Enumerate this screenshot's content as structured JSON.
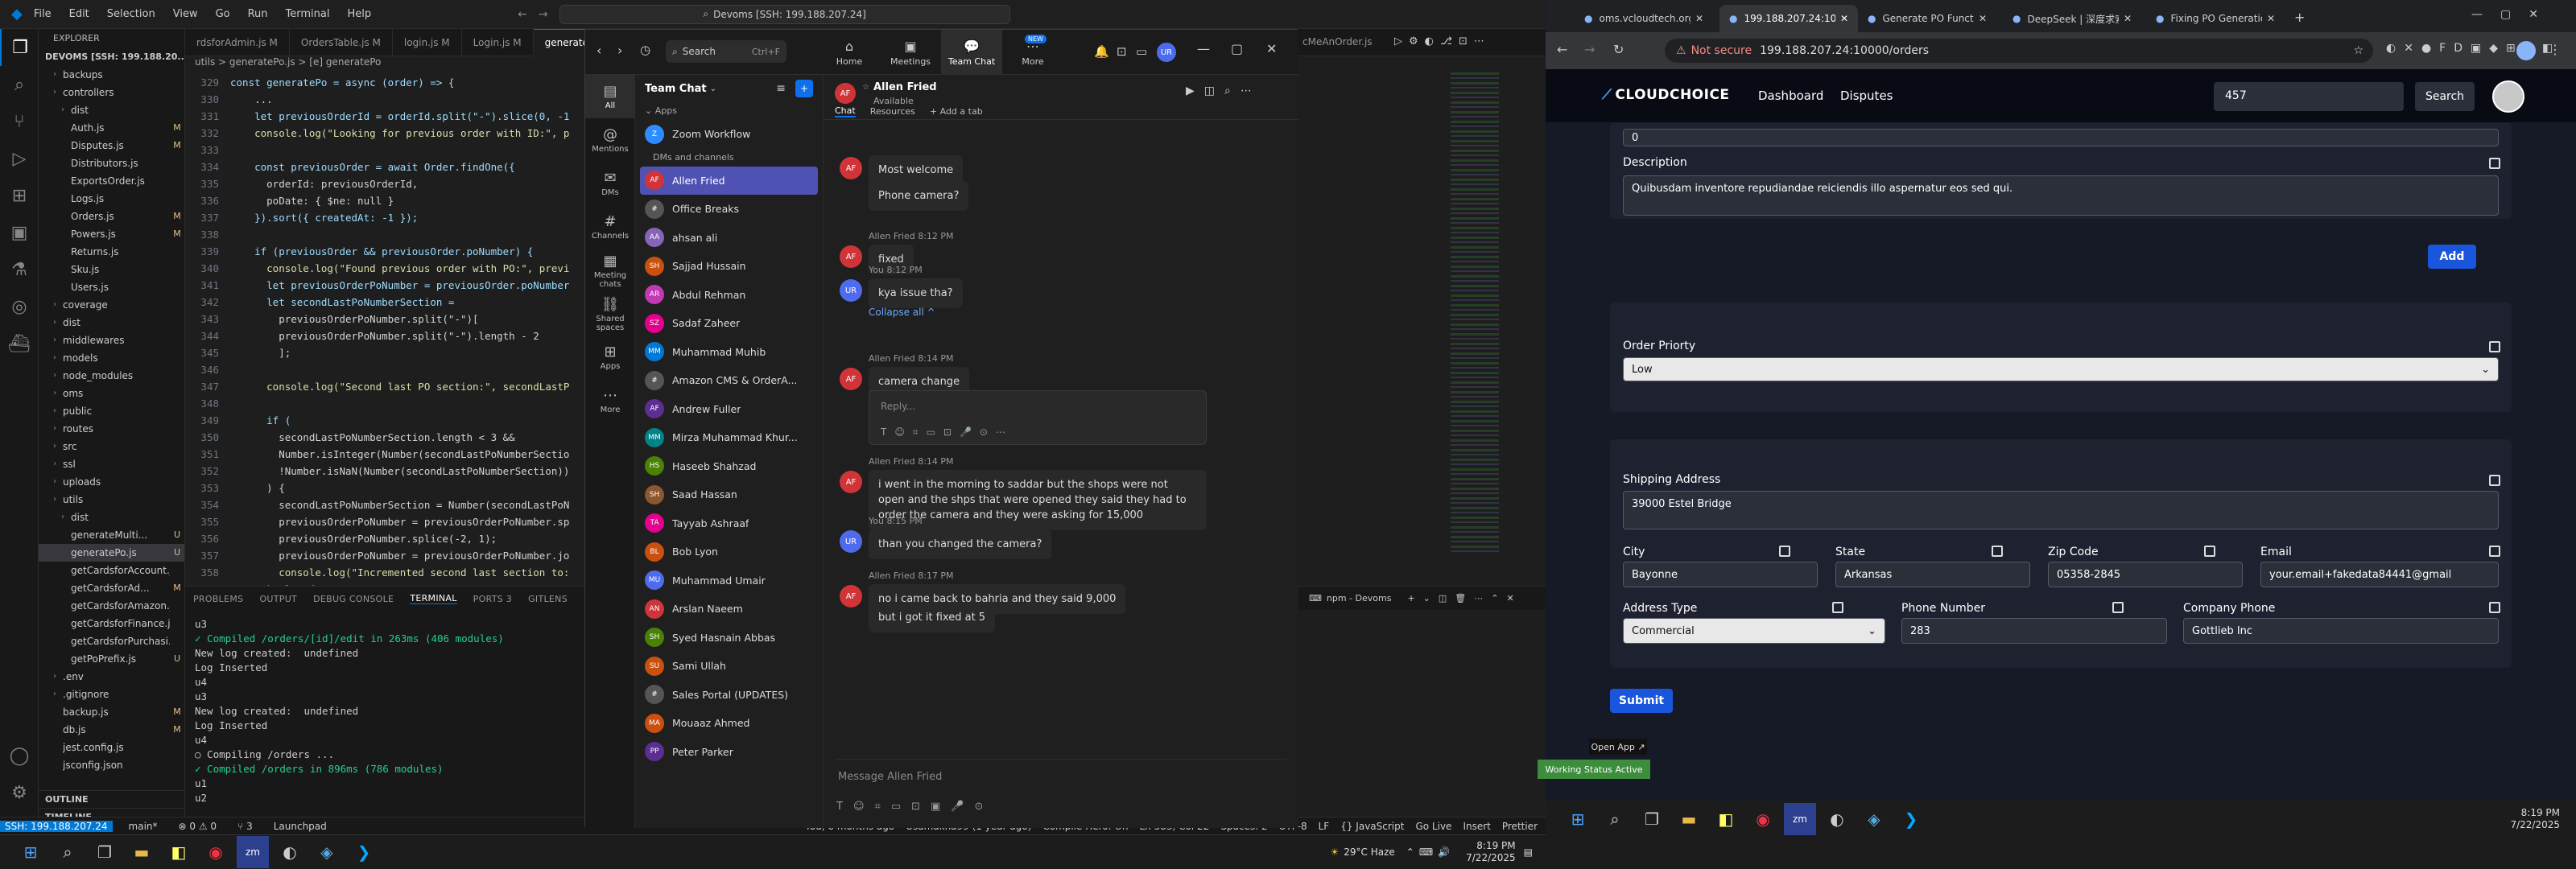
{
  "vscode": {
    "menu": [
      "File",
      "Edit",
      "Selection",
      "View",
      "Go",
      "Run",
      "Terminal",
      "Help"
    ],
    "search": "Devoms [SSH: 199.188.207.24]",
    "explorer_label": "EXPLORER",
    "root": "DEVOMS [SSH: 199.188.20...",
    "files": [
      {
        "name": "backups",
        "depth": 1,
        "status": ""
      },
      {
        "name": "controllers",
        "depth": 1,
        "status": ""
      },
      {
        "name": "dist",
        "depth": 2,
        "status": ""
      },
      {
        "name": "Auth.js",
        "depth": 2,
        "status": "M"
      },
      {
        "name": "Disputes.js",
        "depth": 2,
        "status": "M"
      },
      {
        "name": "Distributors.js",
        "depth": 2,
        "status": ""
      },
      {
        "name": "ExportsOrder.js",
        "depth": 2,
        "status": ""
      },
      {
        "name": "Logs.js",
        "depth": 2,
        "status": ""
      },
      {
        "name": "Orders.js",
        "depth": 2,
        "status": "M"
      },
      {
        "name": "Powers.js",
        "depth": 2,
        "status": "M"
      },
      {
        "name": "Returns.js",
        "depth": 2,
        "status": ""
      },
      {
        "name": "Sku.js",
        "depth": 2,
        "status": ""
      },
      {
        "name": "Users.js",
        "depth": 2,
        "status": ""
      },
      {
        "name": "coverage",
        "depth": 1,
        "status": ""
      },
      {
        "name": "dist",
        "depth": 1,
        "status": ""
      },
      {
        "name": "middlewares",
        "depth": 1,
        "status": ""
      },
      {
        "name": "models",
        "depth": 1,
        "status": ""
      },
      {
        "name": "node_modules",
        "depth": 1,
        "status": ""
      },
      {
        "name": "oms",
        "depth": 1,
        "status": ""
      },
      {
        "name": "public",
        "depth": 1,
        "status": ""
      },
      {
        "name": "routes",
        "depth": 1,
        "status": ""
      },
      {
        "name": "src",
        "depth": 1,
        "status": ""
      },
      {
        "name": "ssl",
        "depth": 1,
        "status": ""
      },
      {
        "name": "uploads",
        "depth": 1,
        "status": ""
      },
      {
        "name": "utils",
        "depth": 1,
        "status": ""
      },
      {
        "name": "dist",
        "depth": 2,
        "status": ""
      },
      {
        "name": "generateMulti...",
        "depth": 2,
        "status": "U"
      },
      {
        "name": "generatePo.js",
        "depth": 2,
        "status": "U"
      },
      {
        "name": "getCardsforAccount.js",
        "depth": 2,
        "status": ""
      },
      {
        "name": "getCardsforAd...",
        "depth": 2,
        "status": "M"
      },
      {
        "name": "getCardsforAmazon.js",
        "depth": 2,
        "status": ""
      },
      {
        "name": "getCardsforFinance.js",
        "depth": 2,
        "status": ""
      },
      {
        "name": "getCardsforPurchasi...",
        "depth": 2,
        "status": ""
      },
      {
        "name": "getPoPrefix.js",
        "depth": 2,
        "status": "U"
      },
      {
        "name": ".env",
        "depth": 1,
        "status": ""
      },
      {
        "name": ".gitignore",
        "depth": 1,
        "status": ""
      },
      {
        "name": "backup.js",
        "depth": 1,
        "status": "M"
      },
      {
        "name": "db.js",
        "depth": 1,
        "status": "M"
      },
      {
        "name": "jest.config.js",
        "depth": 1,
        "status": ""
      },
      {
        "name": "jsconfig.json",
        "depth": 1,
        "status": ""
      }
    ],
    "outline": "OUTLINE",
    "timeline": "TIMELINE",
    "tabs": [
      {
        "label": "rdsforAdmin.js M"
      },
      {
        "label": "OrdersTable.js M"
      },
      {
        "label": "login.js M"
      },
      {
        "label": "Login.js M"
      },
      {
        "label": "generatePo.js U"
      },
      {
        "label": "cMeAnOrder.js"
      }
    ],
    "breadcrumb": "utils  >  generatePo.js  >  [e] generatePo",
    "code": [
      {
        "n": "329",
        "t": "const generatePo = async (order) => {"
      },
      {
        "n": "330",
        "t": "    ..."
      },
      {
        "n": "331",
        "t": "    let previousOrderId = orderId.split(\"-\").slice(0, -1"
      },
      {
        "n": "332",
        "t": "    console.log(\"Looking for previous order with ID:\", p"
      },
      {
        "n": "333",
        "t": ""
      },
      {
        "n": "334",
        "t": "    const previousOrder = await Order.findOne({"
      },
      {
        "n": "335",
        "t": "      orderId: previousOrderId,"
      },
      {
        "n": "336",
        "t": "      poDate: { $ne: null }"
      },
      {
        "n": "337",
        "t": "    }).sort({ createdAt: -1 });"
      },
      {
        "n": "338",
        "t": ""
      },
      {
        "n": "339",
        "t": "    if (previousOrder && previousOrder.poNumber) {"
      },
      {
        "n": "340",
        "t": "      console.log(\"Found previous order with PO:\", previ"
      },
      {
        "n": "341",
        "t": "      let previousOrderPoNumber = previousOrder.poNumber"
      },
      {
        "n": "342",
        "t": "      let secondLastPoNumberSection ="
      },
      {
        "n": "343",
        "t": "        previousOrderPoNumber.split(\"-\")["
      },
      {
        "n": "344",
        "t": "        previousOrderPoNumber.split(\"-\").length - 2"
      },
      {
        "n": "345",
        "t": "        ];"
      },
      {
        "n": "346",
        "t": ""
      },
      {
        "n": "347",
        "t": "      console.log(\"Second last PO section:\", secondLastP"
      },
      {
        "n": "348",
        "t": ""
      },
      {
        "n": "349",
        "t": "      if ("
      },
      {
        "n": "350",
        "t": "        secondLastPoNumberSection.length < 3 &&"
      },
      {
        "n": "351",
        "t": "        Number.isInteger(Number(secondLastPoNumberSectio"
      },
      {
        "n": "352",
        "t": "        !Number.isNaN(Number(secondLastPoNumberSection))"
      },
      {
        "n": "353",
        "t": "      ) {"
      },
      {
        "n": "354",
        "t": "        secondLastPoNumberSection = Number(secondLastPoN"
      },
      {
        "n": "355",
        "t": "        previousOrderPoNumber = previousOrderPoNumber.sp"
      },
      {
        "n": "356",
        "t": "        previousOrderPoNumber.splice(-2, 1);"
      },
      {
        "n": "357",
        "t": "        previousOrderPoNumber = previousOrderPoNumber.jo"
      },
      {
        "n": "358",
        "t": "        console.log(\"Incremented second last section to:"
      },
      {
        "n": "359",
        "t": "      } else {"
      },
      {
        "n": "360",
        "t": "        secondLastPoNumberSection = 1;"
      },
      {
        "n": "361",
        "t": "        console.log(\"Setting second last section to defa"
      }
    ],
    "panel_tabs": [
      "PROBLEMS",
      "OUTPUT",
      "DEBUG CONSOLE",
      "TERMINAL",
      "PORTS 3",
      "GITLENS"
    ],
    "terminal_label": "npm - Devoms",
    "terminal": [
      "u3",
      "✓ Compiled /orders/[id]/edit in 263ms (406 modules)",
      "New log created:  undefined",
      "Log Inserted",
      "u4",
      "u3",
      "New log created:  undefined",
      "Log Inserted",
      "u4",
      "○ Compiling /orders ...",
      "✓ Compiled /orders in 896ms (786 modules)",
      "u1",
      "u2"
    ],
    "status_left": [
      "SSH: 199.188.207.24",
      "main*",
      "⊗ 0 ⚠ 0",
      "⑂ 3",
      "Launchpad"
    ],
    "status_right": [
      "You, 6 months ago",
      "Usamakha99 (1 year ago)",
      "Compile Hero: On",
      "Ln 383, Col 22",
      "Spaces: 2",
      "UTF-8",
      "LF",
      "{} JavaScript",
      "Go Live",
      "Insert",
      "Prettier"
    ]
  },
  "taskbar_left": {
    "weather": "29°C  Haze",
    "time": "8:19 PM",
    "date": "7/22/2025"
  },
  "teams": {
    "search": "Search",
    "shortcut": "Ctrl+F",
    "top_nav": [
      "Home",
      "Meetings",
      "Team Chat",
      "More"
    ],
    "new_badge": "NEW",
    "user_initials": "UR",
    "rail": [
      "All",
      "Mentions",
      "DMs",
      "Channels",
      "Meeting chats",
      "Shared spaces",
      "Apps",
      "More"
    ],
    "list_title": "Team Chat",
    "apps_header": "Apps",
    "dms_header": "DMs and channels",
    "contacts": [
      {
        "name": "Zoom Workflow",
        "initials": "Z",
        "color": "#2d8cff"
      },
      {
        "name": "Allen Fried",
        "initials": "AF",
        "color": "#d13438",
        "selected": true
      },
      {
        "name": "Office Breaks",
        "initials": "#",
        "color": "#555"
      },
      {
        "name": "ahsan ali",
        "initials": "AA",
        "color": "#8764b8"
      },
      {
        "name": "Sajjad Hussain",
        "initials": "SH",
        "color": "#ca5010"
      },
      {
        "name": "Abdul Rehman",
        "initials": "AR",
        "color": "#c239b3"
      },
      {
        "name": "Sadaf Zaheer",
        "initials": "SZ",
        "color": "#e3008c"
      },
      {
        "name": "Muhammad Muhib",
        "initials": "MM",
        "color": "#0078d4"
      },
      {
        "name": "Amazon CMS & OrderA...",
        "initials": "#",
        "color": "#555"
      },
      {
        "name": "Andrew Fuller",
        "initials": "AF",
        "color": "#5c2e91"
      },
      {
        "name": "Mirza Muhammad Khur...",
        "initials": "MM",
        "color": "#038387"
      },
      {
        "name": "Haseeb Shahzad",
        "initials": "HS",
        "color": "#498205"
      },
      {
        "name": "Saad Hassan",
        "initials": "SH",
        "color": "#8e562e"
      },
      {
        "name": "Tayyab Ashraaf",
        "initials": "TA",
        "color": "#e3008c"
      },
      {
        "name": "Bob Lyon",
        "initials": "BL",
        "color": "#ca5010"
      },
      {
        "name": "Muhammad Umair",
        "initials": "MU",
        "color": "#4f6bed"
      },
      {
        "name": "Arslan Naeem",
        "initials": "AN",
        "color": "#d13438"
      },
      {
        "name": "Syed Hasnain Abbas",
        "initials": "SH",
        "color": "#498205"
      },
      {
        "name": "Sami Ullah",
        "initials": "SU",
        "color": "#ca5010"
      },
      {
        "name": "Sales Portal (UPDATES)",
        "initials": "#",
        "color": "#555"
      },
      {
        "name": "Mouaaz Ahmed",
        "initials": "MA",
        "color": "#ca5010"
      },
      {
        "name": "Peter Parker",
        "initials": "PP",
        "color": "#5c2e91"
      }
    ],
    "chat": {
      "name": "Allen Fried",
      "status": "Available",
      "tabs": [
        "Chat",
        "Resources",
        "+ Add a tab"
      ],
      "messages": [
        {
          "who": "AF",
          "text": "Most welcome",
          "meta": ""
        },
        {
          "who": "AF",
          "text": "Phone camera?",
          "meta": ""
        },
        {
          "who": "AF",
          "text": "fixed",
          "meta": "Allen Fried 8:12 PM"
        },
        {
          "who": "UR",
          "text": "kya issue tha?",
          "meta": "You 8:12 PM"
        },
        {
          "who": "AF",
          "text": "camera change",
          "meta": "Allen Fried 8:14 PM"
        },
        {
          "who": "AF",
          "text": "i went in the morning to saddar but the shops were not open and the shps that were opened they said they had to order the camera and they were asking for 15,000",
          "meta": "Allen Fried 8:14 PM"
        },
        {
          "who": "UR",
          "text": "than you changed the camera?",
          "meta": "You 8:15 PM"
        },
        {
          "who": "AF",
          "text": "no i came back to bahria and they said 9,000",
          "meta": "Allen Fried 8:17 PM"
        },
        {
          "who": "AF",
          "text": "but i got it fixed at 5",
          "meta": ""
        }
      ],
      "collapse": "Collapse all ^",
      "reply_placeholder": "Reply...",
      "compose_placeholder": "Message Allen Fried"
    }
  },
  "chrome": {
    "tabs": [
      "oms.vcloudtech.org/das",
      "199.188.207.24:10000/o",
      "Generate PO Function R",
      "DeepSeek | 深度求索",
      "Fixing PO Generation w"
    ],
    "not_secure": "Not secure",
    "url": "199.188.207.24:10000/orders"
  },
  "app": {
    "logo": "CLOUDCHOICE",
    "nav": [
      "Dashboard",
      "Disputes"
    ],
    "search_value": "457",
    "search_btn": "Search",
    "top_value": "0",
    "description_label": "Description",
    "description_value": "Quibusdam inventore repudiandae reiciendis illo aspernatur eos sed qui.",
    "add_btn": "Add",
    "priority_label": "Order Priorty",
    "priority_value": "Low",
    "shipping_label": "Shipping Address",
    "shipping_value": "39000 Estel Bridge",
    "city_label": "City",
    "city_value": "Bayonne",
    "state_label": "State",
    "state_value": "Arkansas",
    "zip_label": "Zip Code",
    "zip_value": "05358-2845",
    "email_label": "Email",
    "email_value": "your.email+fakedata84441@gmail",
    "address_type_label": "Address Type",
    "address_type_value": "Commercial",
    "phone_label": "Phone Number",
    "phone_value": "283",
    "company_phone_label": "Company Phone",
    "company_phone_value": "Gottlieb Inc",
    "submit_btn": "Submit",
    "open_app": "Open App ↗",
    "working_status": "Working Status Active"
  },
  "taskbar_right": {
    "time": "8:19 PM",
    "date": "7/22/2025"
  }
}
